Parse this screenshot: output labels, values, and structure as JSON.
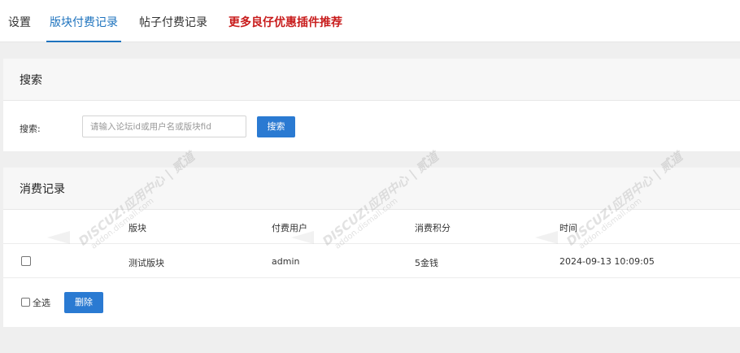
{
  "tabs": [
    {
      "label": "设置",
      "active": false
    },
    {
      "label": "版块付费记录",
      "active": true
    },
    {
      "label": "帖子付费记录",
      "active": false
    },
    {
      "label": "更多良仔优惠插件推荐",
      "active": false,
      "promo": true
    }
  ],
  "search": {
    "title": "搜索",
    "label": "搜索:",
    "placeholder": "请输入论坛id或用户名或版块fid",
    "button_label": "搜索"
  },
  "records": {
    "title": "消费记录",
    "columns": [
      "版块",
      "付费用户",
      "消费积分",
      "时间"
    ],
    "rows": [
      {
        "forum": "测试版块",
        "user": "admin",
        "points": "5金钱",
        "time": "2024-09-13 10:09:05"
      }
    ],
    "select_all_label": "全选",
    "delete_label": "删除"
  },
  "watermark": {
    "main": "DISCUZ!应用中心 | 贰道",
    "sub": "addon.dismall.com"
  },
  "colors": {
    "accent": "#1e73be",
    "button": "#2a7ad2",
    "promo": "#c81c1c"
  }
}
